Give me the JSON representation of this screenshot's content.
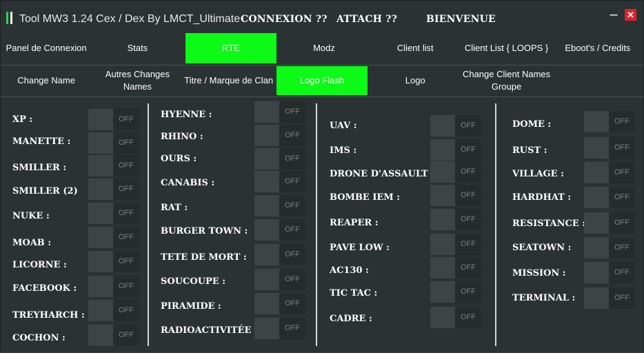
{
  "titlebar": {
    "app_title": "Tool MW3 1.24 Cex / Dex By LMCT_Ultimate",
    "status_connexion": "CONNEXION ??",
    "status_attach": "ATTACH ??",
    "status_welcome": "BIENVENUE",
    "minimize_glyph": "–",
    "close_glyph": "✕",
    "colors": {
      "accent_green": "#2ed84a",
      "close_red": "#e0202a"
    }
  },
  "main_tabs": [
    {
      "label": "Panel de Connexion",
      "active": false
    },
    {
      "label": "Stats",
      "active": false
    },
    {
      "label": "RTE",
      "active": true
    },
    {
      "label": "Modz",
      "active": false
    },
    {
      "label": "Client list",
      "active": false
    },
    {
      "label": "Client List { LOOPS }",
      "active": false
    },
    {
      "label": "Eboot's / Credits",
      "active": false
    }
  ],
  "sub_tabs": [
    {
      "label": "Change Name",
      "active": false
    },
    {
      "label": "Autres Changes Names",
      "active": false
    },
    {
      "label": "Titre / Marque de Clan",
      "active": false
    },
    {
      "label": "Logo Flash",
      "active": true
    },
    {
      "label": "Logo",
      "active": false
    },
    {
      "label": "Change Client Names Groupe",
      "active": false
    },
    {
      "label": "",
      "active": false
    }
  ],
  "toggle_off_label": "OFF",
  "theme": {
    "active_tab": "#0cfa16",
    "background": "#2b3233"
  },
  "columns": [
    {
      "options": [
        {
          "label": "XP :",
          "state": "OFF"
        },
        {
          "label": "MANETTE :",
          "state": "OFF"
        },
        {
          "label": "SMILLER :",
          "state": "OFF"
        },
        {
          "label": "SMILLER (2)",
          "state": "OFF"
        },
        {
          "label": "NUKE :",
          "state": "OFF"
        },
        {
          "label": "MOAB :",
          "state": "OFF"
        },
        {
          "label": "LICORNE :",
          "state": "OFF"
        },
        {
          "label": "FACEBOOK :",
          "state": "OFF"
        },
        {
          "label": "TREYHARCH :",
          "state": "OFF"
        },
        {
          "label": "COCHON :",
          "state": "OFF"
        }
      ]
    },
    {
      "options": [
        {
          "label": "HYENNE :",
          "state": "OFF"
        },
        {
          "label": "RHINO :",
          "state": "OFF"
        },
        {
          "label": "OURS :",
          "state": "OFF"
        },
        {
          "label": "CANABIS :",
          "state": "OFF"
        },
        {
          "label": "RAT :",
          "state": "OFF"
        },
        {
          "label": "BURGER TOWN :",
          "state": "OFF"
        },
        {
          "label": "TETE DE MORT :",
          "state": "OFF"
        },
        {
          "label": "SOUCOUPE :",
          "state": "OFF"
        },
        {
          "label": "PIRAMIDE :",
          "state": "OFF"
        },
        {
          "label": "RADIOACTIVITÉE :",
          "state": "OFF"
        }
      ]
    },
    {
      "options": [
        {
          "label": "UAV :",
          "state": "OFF"
        },
        {
          "label": "IMS :",
          "state": "OFF"
        },
        {
          "label": "DRONE D'ASSAULT :",
          "state": "OFF"
        },
        {
          "label": "BOMBE IEM :",
          "state": "OFF"
        },
        {
          "label": "REAPER :",
          "state": "OFF"
        },
        {
          "label": "PAVE LOW :",
          "state": "OFF"
        },
        {
          "label": "AC130 :",
          "state": "OFF"
        },
        {
          "label": "TIC TAC :",
          "state": "OFF"
        },
        {
          "label": "CADRE :",
          "state": "OFF"
        }
      ]
    },
    {
      "options": [
        {
          "label": "DOME :",
          "state": "OFF"
        },
        {
          "label": "RUST :",
          "state": "OFF"
        },
        {
          "label": "VILLAGE :",
          "state": "OFF"
        },
        {
          "label": "HARDHAT :",
          "state": "OFF"
        },
        {
          "label": "RESISTANCE :",
          "state": "OFF"
        },
        {
          "label": "SEATOWN :",
          "state": "OFF"
        },
        {
          "label": "MISSION :",
          "state": "OFF"
        },
        {
          "label": "TERMINAL :",
          "state": "OFF"
        }
      ]
    }
  ]
}
